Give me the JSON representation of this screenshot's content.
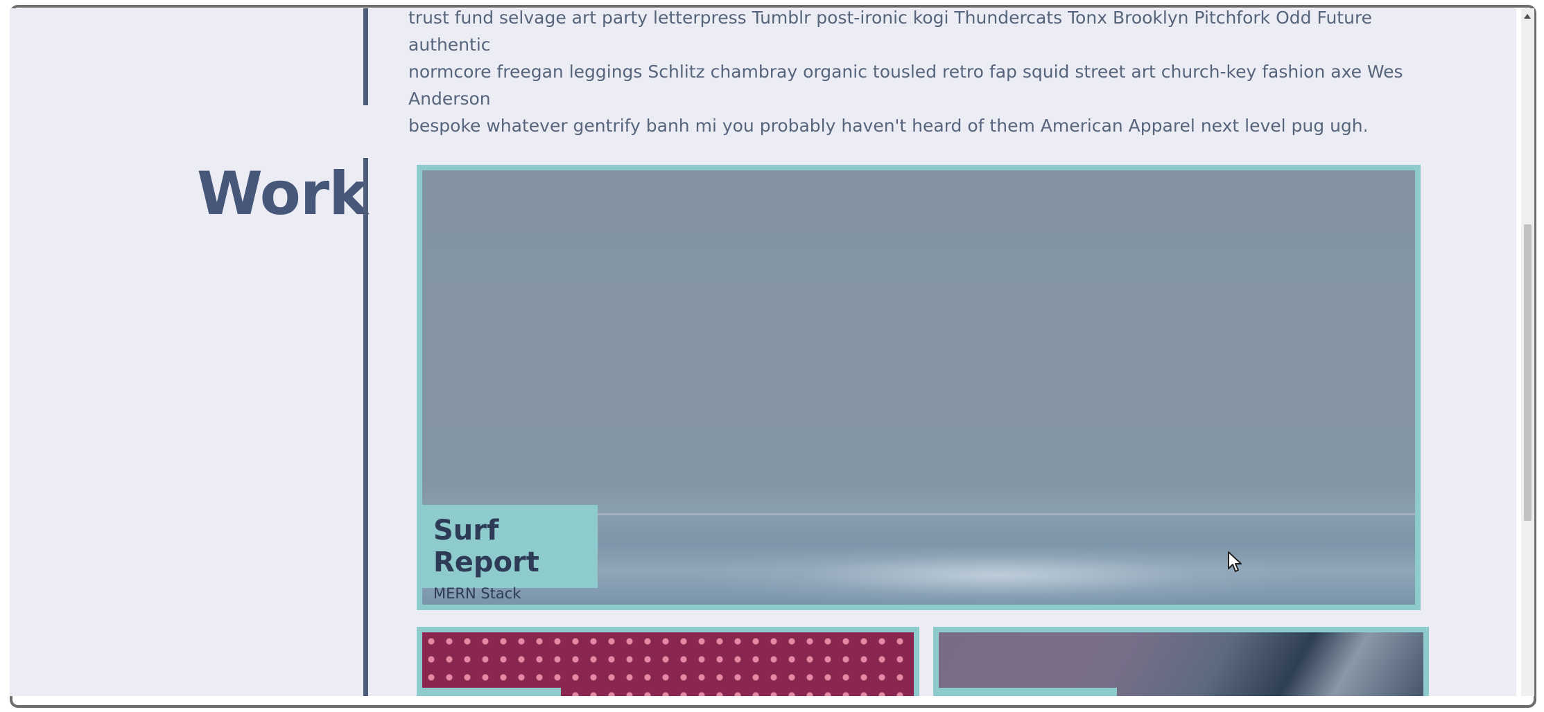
{
  "about": {
    "text_lines": [
      "trust fund selvage art party letterpress Tumblr post-ironic kogi Thundercats Tonx Brooklyn Pitchfork Odd Future authentic",
      "normcore freegan leggings Schlitz chambray organic tousled retro fap squid street art church-key fashion axe Wes Anderson",
      "bespoke whatever gentrify banh mi you probably haven't heard of them American Apparel next level pug ugh."
    ]
  },
  "work": {
    "section_title": "Work",
    "featured_project": {
      "title": "Surf Report",
      "subtitle": "MERN Stack"
    }
  },
  "colors": {
    "background": "#ecedf4",
    "accent_teal": "#8ecbcc",
    "timeline_bar": "#4d5c78",
    "heading": "#47577a",
    "body_text": "#56647c"
  },
  "icons": {
    "cursor": "arrow-cursor-icon",
    "scroll_up": "chevron-up-icon"
  }
}
